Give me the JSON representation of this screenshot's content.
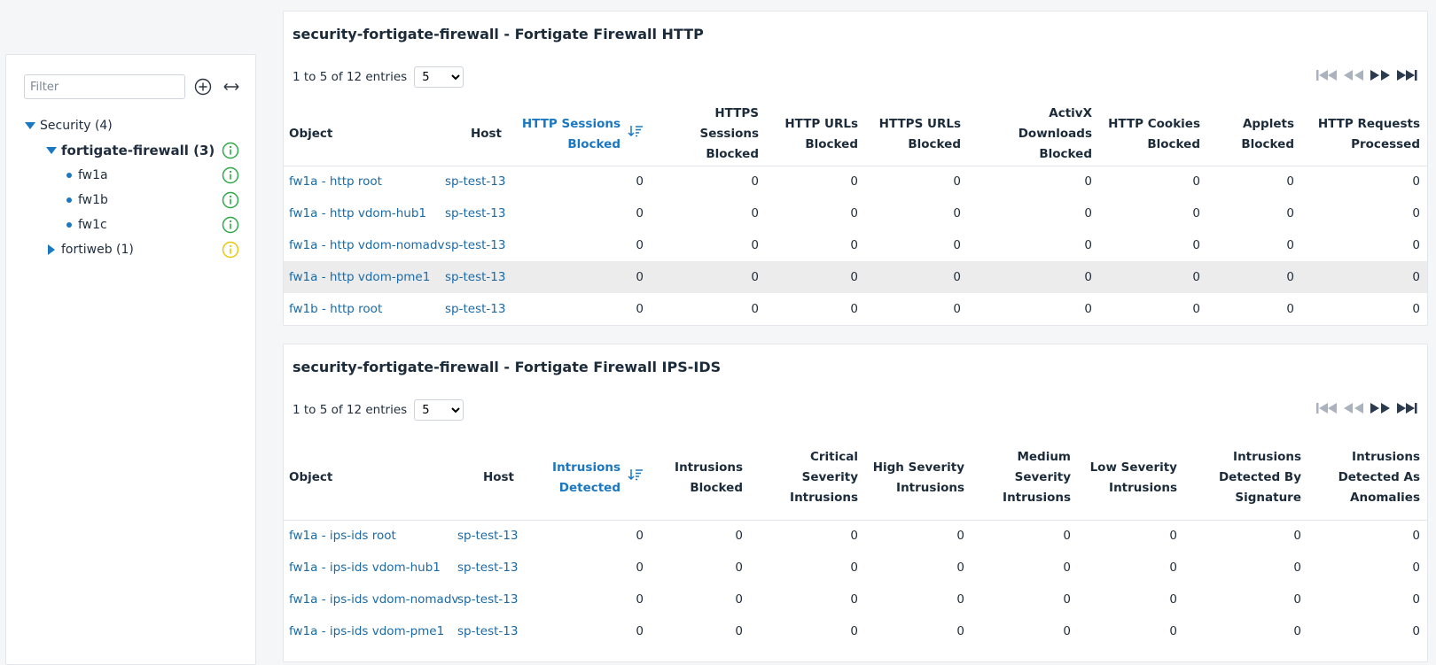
{
  "sidebar": {
    "filter_placeholder": "Filter",
    "tree": [
      {
        "label": "Security (4)",
        "level": 0,
        "expanded": true
      },
      {
        "label": "fortigate-firewall (3)",
        "level": 1,
        "expanded": true,
        "status": "green"
      },
      {
        "label": "fw1a",
        "level": 2,
        "status": "green"
      },
      {
        "label": "fw1b",
        "level": 2,
        "status": "green"
      },
      {
        "label": "fw1c",
        "level": 2,
        "status": "green"
      },
      {
        "label": "fortiweb (1)",
        "level": 1,
        "expanded": false,
        "status": "yellow"
      }
    ]
  },
  "colors": {
    "link": "#1a6aa8",
    "accent": "#1a78c2",
    "status_green": "#2ea84a",
    "status_yellow": "#e6c812"
  },
  "http_panel": {
    "title": "security-fortigate-firewall - Fortigate Firewall HTTP",
    "entries_text": "1 to 5 of 12 entries",
    "page_size": "5",
    "columns": [
      "Object",
      "Host",
      "HTTP Sessions Blocked",
      "HTTPS Sessions Blocked",
      "HTTP URLs Blocked",
      "HTTPS URLs Blocked",
      "ActivX Downloads Blocked",
      "HTTP Cookies Blocked",
      "Applets Blocked",
      "HTTP Requests Processed"
    ],
    "header_lines": [
      [
        "Object"
      ],
      [
        "Host"
      ],
      [
        "HTTP Sessions",
        "Blocked"
      ],
      [
        "HTTPS Sessions",
        "Blocked"
      ],
      [
        "HTTP URLs",
        "Blocked"
      ],
      [
        "HTTPS URLs",
        "Blocked"
      ],
      [
        "ActivX Downloads",
        "Blocked"
      ],
      [
        "HTTP Cookies",
        "Blocked"
      ],
      [
        "Applets",
        "Blocked"
      ],
      [
        "HTTP Requests",
        "Processed"
      ]
    ],
    "rows": [
      [
        "fw1a - http root",
        "sp-test-13",
        "0",
        "0",
        "0",
        "0",
        "0",
        "0",
        "0",
        "0"
      ],
      [
        "fw1a - http vdom-hub1",
        "sp-test-13",
        "0",
        "0",
        "0",
        "0",
        "0",
        "0",
        "0",
        "0"
      ],
      [
        "fw1a - http vdom-nomadv",
        "sp-test-13",
        "0",
        "0",
        "0",
        "0",
        "0",
        "0",
        "0",
        "0"
      ],
      [
        "fw1a - http vdom-pme1",
        "sp-test-13",
        "0",
        "0",
        "0",
        "0",
        "0",
        "0",
        "0",
        "0"
      ],
      [
        "fw1b - http root",
        "sp-test-13",
        "0",
        "0",
        "0",
        "0",
        "0",
        "0",
        "0",
        "0"
      ]
    ]
  },
  "ips_panel": {
    "title": "security-fortigate-firewall - Fortigate Firewall IPS-IDS",
    "entries_text": "1 to 5 of 12 entries",
    "page_size": "5",
    "columns": [
      "Object",
      "Host",
      "Intrusions Detected",
      "Intrusions Blocked",
      "Critical Severity Intrusions",
      "High Severity Intrusions",
      "Medium Severity Intrusions",
      "Low Severity Intrusions",
      "Intrusions Detected By Signature",
      "Intrusions Detected As Anomalies"
    ],
    "header_lines": [
      [
        "Object"
      ],
      [
        "Host"
      ],
      [
        "Intrusions",
        "Detected"
      ],
      [
        "Intrusions",
        "Blocked"
      ],
      [
        "Critical Severity",
        "Intrusions"
      ],
      [
        "High Severity",
        "Intrusions"
      ],
      [
        "Medium",
        "Severity",
        "Intrusions"
      ],
      [
        "Low Severity",
        "Intrusions"
      ],
      [
        "Intrusions",
        "Detected By",
        "Signature"
      ],
      [
        "Intrusions",
        "Detected As",
        "Anomalies"
      ]
    ],
    "rows": [
      [
        "fw1a - ips-ids root",
        "sp-test-13",
        "0",
        "0",
        "0",
        "0",
        "0",
        "0",
        "0",
        "0"
      ],
      [
        "fw1a - ips-ids vdom-hub1",
        "sp-test-13",
        "0",
        "0",
        "0",
        "0",
        "0",
        "0",
        "0",
        "0"
      ],
      [
        "fw1a - ips-ids vdom-nomadv",
        "sp-test-13",
        "0",
        "0",
        "0",
        "0",
        "0",
        "0",
        "0",
        "0"
      ],
      [
        "fw1a - ips-ids vdom-pme1",
        "sp-test-13",
        "0",
        "0",
        "0",
        "0",
        "0",
        "0",
        "0",
        "0"
      ]
    ]
  }
}
